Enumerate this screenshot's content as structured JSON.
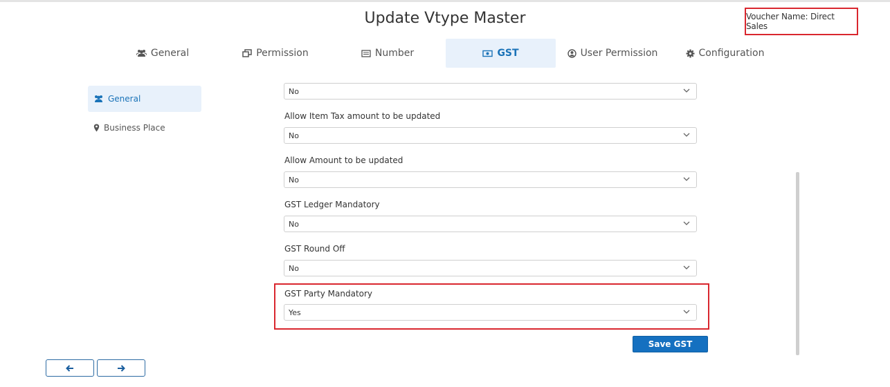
{
  "page": {
    "title": "Update Vtype Master",
    "voucher_label": "Voucher Name: Direct Sales"
  },
  "tabs": [
    {
      "label": "General",
      "icon": "users-icon"
    },
    {
      "label": "Permission",
      "icon": "windows-icon"
    },
    {
      "label": "Number",
      "icon": "list-icon"
    },
    {
      "label": "GST",
      "icon": "money-icon",
      "active": true
    },
    {
      "label": "User Permission",
      "icon": "user-circle-icon"
    },
    {
      "label": "Configuration",
      "icon": "gear-icon"
    }
  ],
  "sidebar": {
    "items": [
      {
        "label": "General",
        "icon": "users-icon",
        "active": true
      },
      {
        "label": "Business Place",
        "icon": "map-marker-icon"
      }
    ]
  },
  "form": {
    "fields": [
      {
        "label": "",
        "value": "No"
      },
      {
        "label": "Allow Item Tax amount to be updated",
        "value": "No"
      },
      {
        "label": "Allow Amount to be updated",
        "value": "No"
      },
      {
        "label": "GST Ledger Mandatory",
        "value": "No"
      },
      {
        "label": "GST Round Off",
        "value": "No"
      },
      {
        "label": "GST Party Mandatory",
        "value": "Yes"
      }
    ],
    "save_label": "Save GST"
  },
  "colors": {
    "accent": "#1570c0",
    "highlight": "#d9262e",
    "active_bg": "#e8f1fb"
  }
}
